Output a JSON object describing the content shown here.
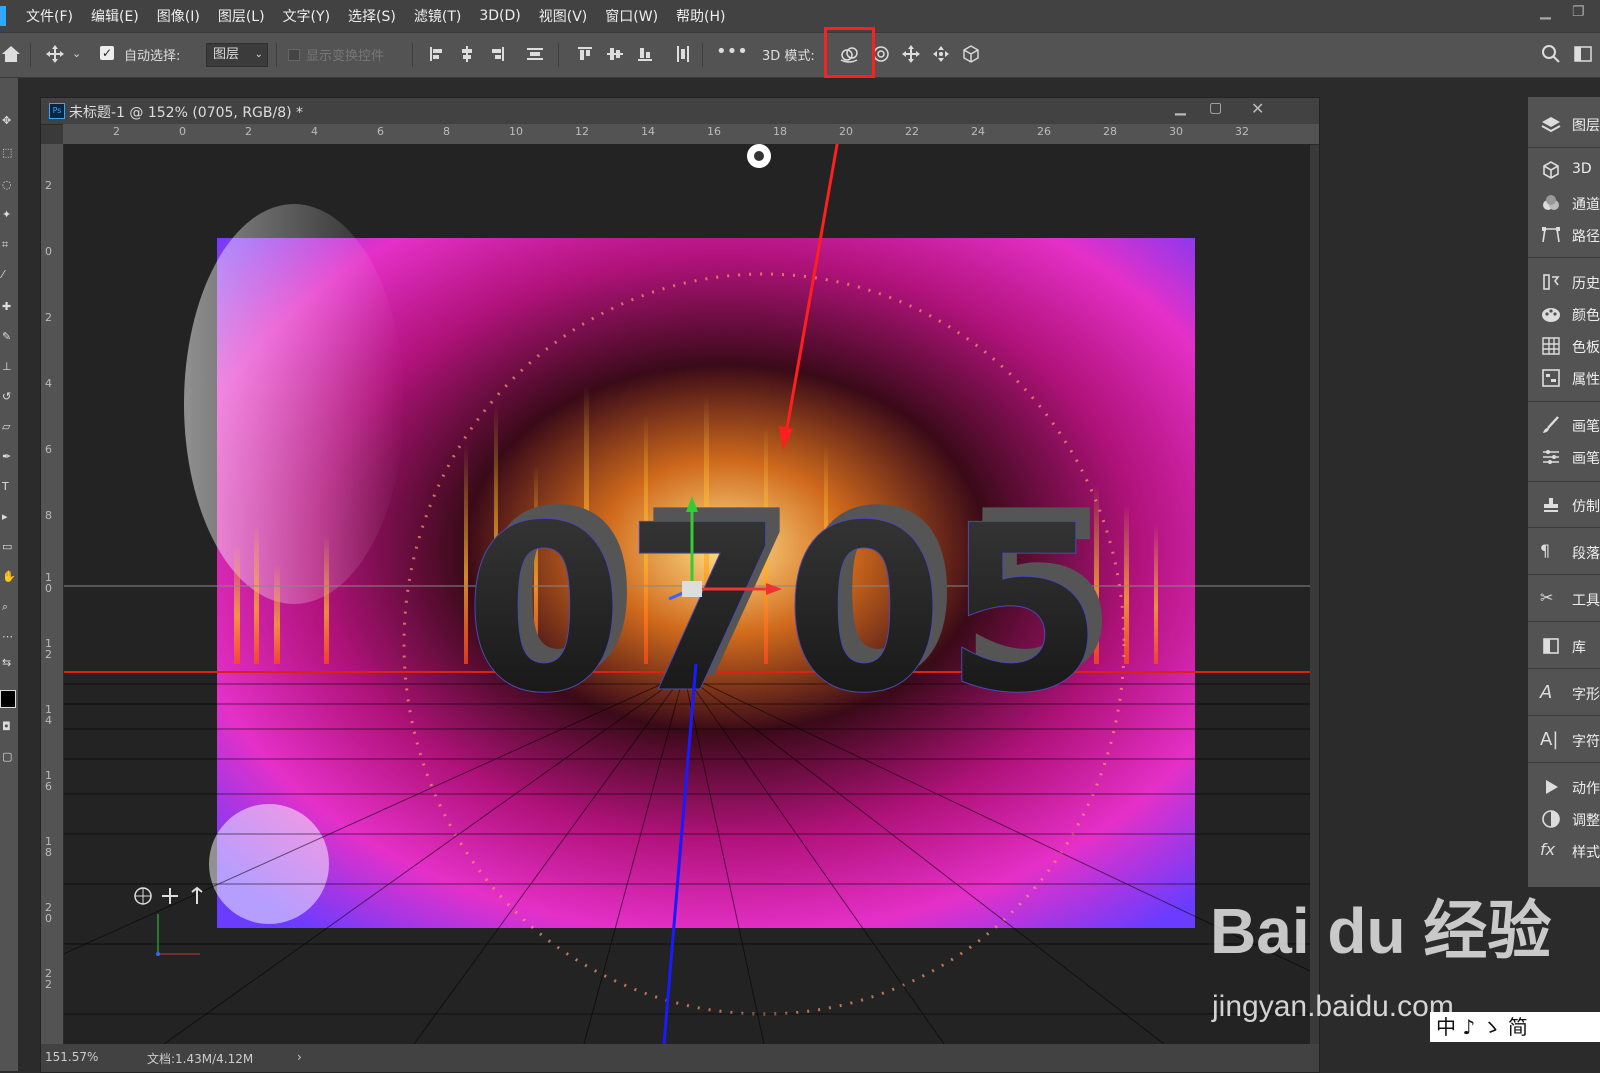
{
  "menubar": {
    "items": [
      "文件(F)",
      "编辑(E)",
      "图像(I)",
      "图层(L)",
      "文字(Y)",
      "选择(S)",
      "滤镜(T)",
      "3D(D)",
      "视图(V)",
      "窗口(W)",
      "帮助(H)"
    ]
  },
  "options": {
    "auto_select_label": "自动选择:",
    "auto_select_checked": true,
    "auto_select_value": "图层",
    "show_transform_label": "显示变换控件",
    "mode_3d_label": "3D 模式:"
  },
  "document": {
    "title": "未标题-1 @ 152% (0705, RGB/8) *",
    "ruler_top": [
      "2",
      "0",
      "2",
      "4",
      "6",
      "8",
      "10",
      "12",
      "14",
      "16",
      "18",
      "20",
      "22",
      "24",
      "26",
      "28",
      "30",
      "32"
    ],
    "ruler_left": [
      "2",
      "0",
      "2",
      "4",
      "6",
      "8",
      "1\n0",
      "1\n2",
      "1\n4",
      "1\n6",
      "1\n8",
      "2\n0",
      "2\n2"
    ],
    "scene_text": "0705",
    "zoom": "151.57%",
    "doc_size": "文档:1.43M/4.12M"
  },
  "panels": [
    {
      "label": "图层",
      "icon": "layers-icon"
    },
    {
      "label": "3D",
      "icon": "cube-icon"
    },
    {
      "label": "通道",
      "icon": "channels-icon"
    },
    {
      "label": "路径",
      "icon": "paths-icon"
    },
    {
      "label": "历史",
      "icon": "history-icon"
    },
    {
      "label": "颜色",
      "icon": "palette-icon"
    },
    {
      "label": "色板",
      "icon": "swatches-icon"
    },
    {
      "label": "属性",
      "icon": "properties-icon"
    },
    {
      "label": "画笔",
      "icon": "brush-icon"
    },
    {
      "label": "画笔",
      "icon": "brush-settings-icon"
    },
    {
      "label": "仿制",
      "icon": "clone-source-icon"
    },
    {
      "label": "段落",
      "icon": "paragraph-icon"
    },
    {
      "label": "工具",
      "icon": "tool-presets-icon"
    },
    {
      "label": "库",
      "icon": "libraries-icon"
    },
    {
      "label": "字形",
      "icon": "glyphs-icon"
    },
    {
      "label": "字符",
      "icon": "character-icon"
    },
    {
      "label": "动作",
      "icon": "play-icon"
    },
    {
      "label": "调整",
      "icon": "adjustments-icon"
    },
    {
      "label": "样式",
      "icon": "styles-icon"
    }
  ],
  "watermark": {
    "brand": "Bai du 经验",
    "url": "jingyan.baidu.com"
  },
  "ime": {
    "text": "中 ♪ ゝ 简"
  },
  "colors": {
    "highlight": "#ff1f1f",
    "accent": "#31a8ff"
  }
}
